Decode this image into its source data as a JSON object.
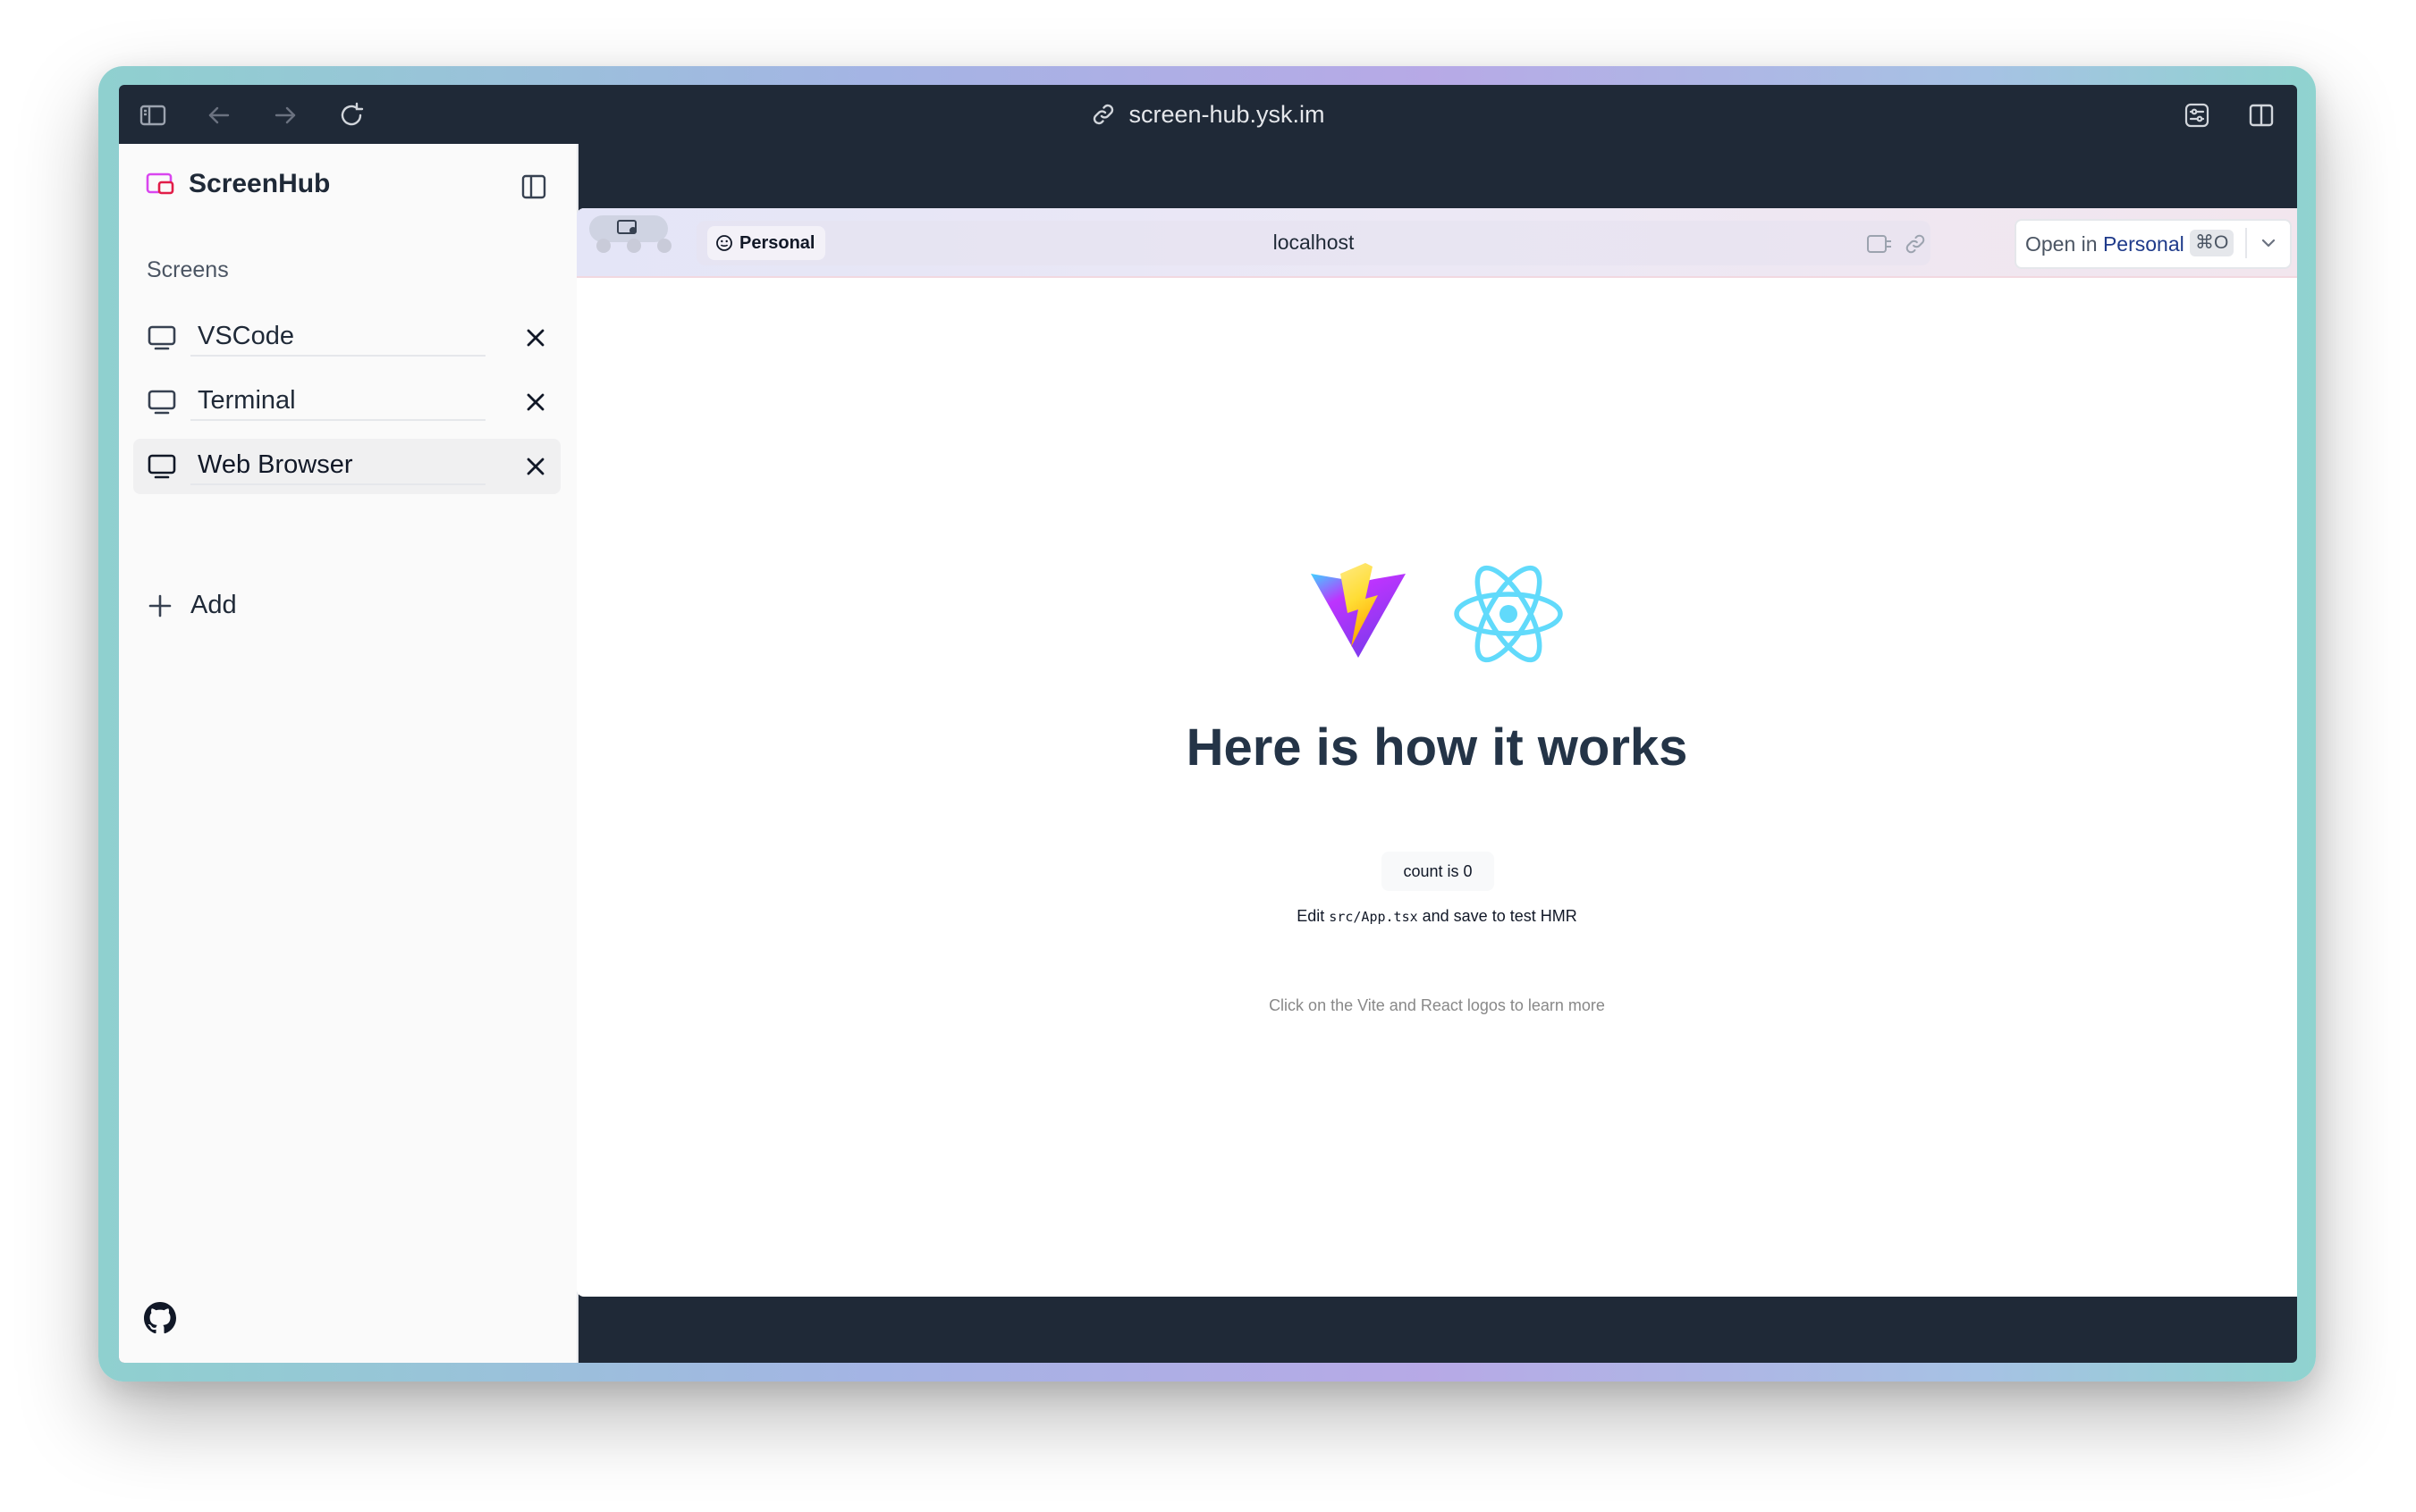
{
  "browser": {
    "url": "screen-hub.ysk.im",
    "icons": [
      "sidebar-icon",
      "back-arrow-icon",
      "forward-arrow-icon",
      "reload-icon",
      "link-icon",
      "extensions-icon",
      "split-view-icon"
    ]
  },
  "sidebar": {
    "brand": "ScreenHub",
    "section_label": "Screens",
    "screens": [
      {
        "name": "VSCode"
      },
      {
        "name": "Terminal"
      },
      {
        "name": "Web Browser"
      }
    ],
    "add_label": "Add"
  },
  "embedded_browser": {
    "profile": "Personal",
    "host": "localhost",
    "open_in_prefix": "Open in ",
    "open_in_profile": "Personal",
    "shortcut": "⌘O"
  },
  "page": {
    "headline": "Here is how it works",
    "count_button": "count is 0",
    "edit_prefix": "Edit ",
    "edit_code": "src/App.tsx",
    "edit_suffix": " and save to test HMR",
    "read_docs": "Click on the Vite and React logos to learn more"
  },
  "colors": {
    "titlebar": "#1f2937",
    "sidebar_bg": "#fafafa",
    "brand_accent": "#d946ef",
    "react": "#61dafb",
    "vite_purple": "#a855f7",
    "vite_yellow": "#fbbf24",
    "open_in_profile": "#1e3a8a"
  }
}
